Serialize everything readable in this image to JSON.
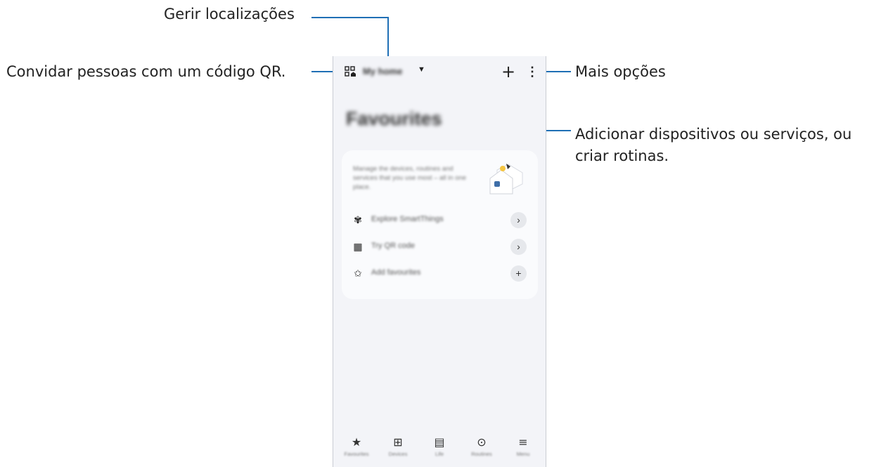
{
  "callouts": {
    "manage_locations": "Gerir localizações",
    "invite_qr": "Convidar pessoas com um código QR.",
    "more_options": "Mais opções",
    "add_devices_line1": "Adicionar dispositivos ou serviços, ou",
    "add_devices_line2": "criar rotinas."
  },
  "colors": {
    "callout_line": "#1f6fb5",
    "phone_background": "#f3f4f8",
    "card_background": "#fafbfd"
  },
  "app": {
    "header": {
      "location_name": "My home",
      "qr_icon": "qr-code-home-icon",
      "caret_icon": "caret-down-icon",
      "add_glyph": "+",
      "more_glyph": "⋮"
    },
    "page_title": "Favourites",
    "card": {
      "description": "Manage the devices, routines and services that you use most – all in one place.",
      "rows": [
        {
          "icon": "explore-icon",
          "glyph": "✾",
          "label": "Explore SmartThings",
          "action": "›"
        },
        {
          "icon": "qr-code-icon",
          "glyph": "▦",
          "label": "Try QR code",
          "action": "›"
        },
        {
          "icon": "star-outline-icon",
          "glyph": "✩",
          "label": "Add favourites",
          "action": "+"
        }
      ]
    },
    "bottom_nav": [
      {
        "icon": "star-icon",
        "glyph": "★",
        "label": "Favourites"
      },
      {
        "icon": "devices-icon",
        "glyph": "⊞",
        "label": "Devices"
      },
      {
        "icon": "life-icon",
        "glyph": "▤",
        "label": "Life"
      },
      {
        "icon": "routines-icon",
        "glyph": "⊙",
        "label": "Routines"
      },
      {
        "icon": "menu-icon",
        "glyph": "≡",
        "label": "Menu"
      }
    ]
  }
}
